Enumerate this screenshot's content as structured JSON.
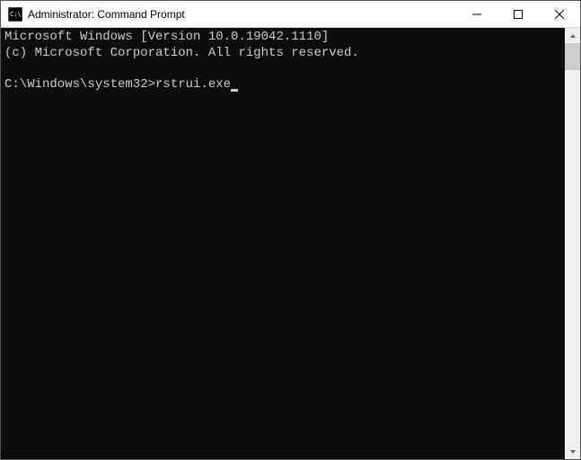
{
  "window": {
    "title": "Administrator: Command Prompt"
  },
  "terminal": {
    "banner_line1": "Microsoft Windows [Version 10.0.19042.1110]",
    "banner_line2": "(c) Microsoft Corporation. All rights reserved.",
    "prompt": "C:\\Windows\\system32>",
    "command": "rstrui.exe"
  }
}
